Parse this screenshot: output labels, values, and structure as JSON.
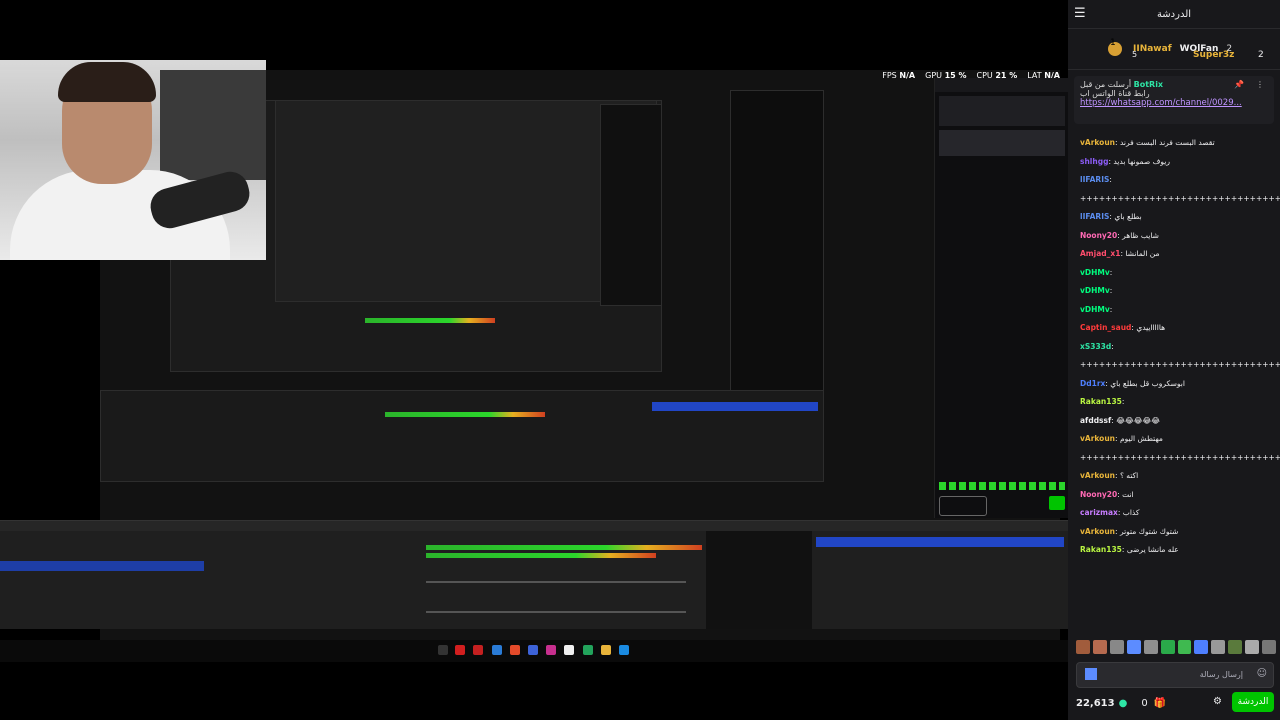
{
  "stream": {
    "status": {
      "fps_label": "FPS",
      "fps_value": "N/A",
      "gpu_label": "GPU",
      "gpu_value": "15 %",
      "cpu_label": "CPU",
      "cpu_value": "21 %",
      "lat_label": "LAT",
      "lat_value": "N/A"
    }
  },
  "chat": {
    "title": "الدردشة",
    "leaderboard": {
      "first": {
        "rank": "1",
        "name": "IINawaf",
        "count": "5"
      },
      "second": {
        "name": "WOlFan",
        "count": "2"
      },
      "third": {
        "name": "Super3z",
        "count": "2"
      }
    },
    "pinned": {
      "sent_by": "أرسلت من قبل",
      "author": "BotRix",
      "text": "رابط قناة الواتس اب",
      "link": "https://whatsapp.com/channel/0029..."
    },
    "messages": [
      {
        "user": "vArkoun",
        "color": "#e8b43a",
        "text": "تقصد البست فرند البست فرند"
      },
      {
        "user": "shlhgg",
        "color": "#8b5cf6",
        "text": "ريوف صمونها بديد"
      },
      {
        "user": "lIFARIS",
        "color": "#5b8def",
        "text": ""
      },
      {
        "user": "",
        "color": "#efeff1",
        "text": "++++++++++++++++++++++++++++++++++++++++"
      },
      {
        "user": "lIFARIS",
        "color": "#5b8def",
        "text": "بطلع باي"
      },
      {
        "user": "Noony20",
        "color": "#ff69b4",
        "text": "شايب ظاهر"
      },
      {
        "user": "Amjad_x1",
        "color": "#ff4d6d",
        "text": "من المانشا"
      },
      {
        "user": "vDHMv",
        "color": "#00ff7f",
        "text": ""
      },
      {
        "user": "vDHMv",
        "color": "#00ff7f",
        "text": ""
      },
      {
        "user": "vDHMv",
        "color": "#00ff7f",
        "text": ""
      },
      {
        "user": "Captin_saud",
        "color": "#ff3b3b",
        "text": "هاااااييدي"
      },
      {
        "user": "xS333d",
        "color": "#2ee6a6",
        "text": ""
      },
      {
        "user": "",
        "color": "#efeff1",
        "text": "++++++++++++++++++++++++++++++++++++++++"
      },
      {
        "user": "Dd1rx",
        "color": "#4e7fff",
        "text": "ابوسكروب قل بطلع باي"
      },
      {
        "user": "Rakan135",
        "color": "#b9f542",
        "text": ""
      },
      {
        "user": "afddssf",
        "color": "#efeff1",
        "text": "😂😂😂😂😂"
      },
      {
        "user": "vArkoun",
        "color": "#e8b43a",
        "text": "مهتطش اليوم"
      },
      {
        "user": "",
        "color": "#efeff1",
        "text": "++++++++++++++++++++++++++++++++++++++++"
      },
      {
        "user": "vArkoun",
        "color": "#e8b43a",
        "text": "اكته ؟"
      },
      {
        "user": "Noony20",
        "color": "#ff69b4",
        "text": "انت"
      },
      {
        "user": "carizmax",
        "color": "#c77dff",
        "text": "كذاب"
      },
      {
        "user": "vArkoun",
        "color": "#e8b43a",
        "text": "شتوك شتوك متوتر"
      },
      {
        "user": "Rakan135",
        "color": "#b9f542",
        "text": "عله مانشا يرضى"
      }
    ],
    "input_placeholder": "إرسال رسالة",
    "points": "22,613",
    "gift_count": "0",
    "chat_button": "الدردشة"
  }
}
